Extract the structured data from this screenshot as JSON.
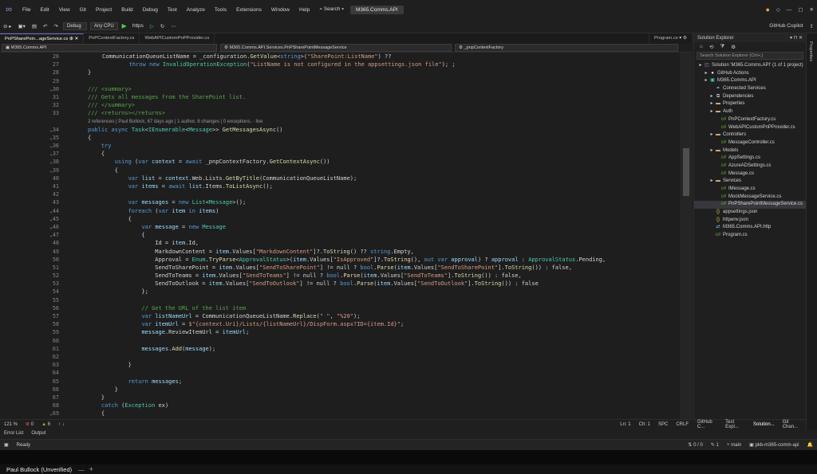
{
  "menu": [
    "File",
    "Edit",
    "View",
    "Git",
    "Project",
    "Build",
    "Debug",
    "Test",
    "Analyze",
    "Tools",
    "Extensions",
    "Window",
    "Help"
  ],
  "search_label": "Search",
  "window_title": "M365.Comms.API",
  "copilot_label": "GitHub Copilot",
  "toolbar": {
    "config": "Debug",
    "platform": "Any CPU",
    "run": "https"
  },
  "doc_tabs": [
    {
      "label": "PnPSharePoin...ageService.cs",
      "active": true
    },
    {
      "label": "PnPContextFactory.cs",
      "active": false
    },
    {
      "label": "WebAPICustomPnPProvider.cs",
      "active": false
    },
    {
      "label": "Program.cs",
      "active": false
    }
  ],
  "nav": {
    "project": "M365.Comms.API",
    "class": "M365.Comms.API.Services.PnPSharePointMessageService",
    "member": "_pnpContextFactory"
  },
  "codelens": "2 references | Paul Bullock, 67 days ago | 1 author, 8 changes | 0 exceptions, - live",
  "editor_status": {
    "zoom": "121 %",
    "errors": "0",
    "warnings": "6",
    "ln": "Ln: 1",
    "ch": "Ch: 1",
    "spc": "SPC",
    "crlf": "CRLF"
  },
  "output_tabs": [
    "Error List",
    "Output"
  ],
  "solution_explorer": {
    "title": "Solution Explorer",
    "search_placeholder": "Search Solution Explorer (Ctrl+;)",
    "items": [
      {
        "label": "Solution 'M365.Comms.API' (1 of 1 project)",
        "indent": 0,
        "icon": "solution-icon"
      },
      {
        "label": "GitHub Actions",
        "indent": 1,
        "icon": "github-icon"
      },
      {
        "label": "M365.Comms.API",
        "indent": 1,
        "icon": "project-icon"
      },
      {
        "label": "Connected Services",
        "indent": 2,
        "icon": "connected-icon"
      },
      {
        "label": "Dependencies",
        "indent": 2,
        "icon": "deps-icon"
      },
      {
        "label": "Properties",
        "indent": 2,
        "icon": "folder-icon"
      },
      {
        "label": "Auth",
        "indent": 2,
        "icon": "folder-icon"
      },
      {
        "label": "PnPContextFactory.cs",
        "indent": 3,
        "icon": "cs-icon"
      },
      {
        "label": "WebAPICustomPnPProvider.cs",
        "indent": 3,
        "icon": "cs-icon"
      },
      {
        "label": "Controllers",
        "indent": 2,
        "icon": "folder-icon"
      },
      {
        "label": "MessageController.cs",
        "indent": 3,
        "icon": "cs-icon"
      },
      {
        "label": "Models",
        "indent": 2,
        "icon": "folder-icon"
      },
      {
        "label": "AppSettings.cs",
        "indent": 3,
        "icon": "cs-icon"
      },
      {
        "label": "AzureADSettings.cs",
        "indent": 3,
        "icon": "cs-icon"
      },
      {
        "label": "Message.cs",
        "indent": 3,
        "icon": "cs-icon"
      },
      {
        "label": "Services",
        "indent": 2,
        "icon": "folder-icon"
      },
      {
        "label": "IMessage.cs",
        "indent": 3,
        "icon": "cs-icon"
      },
      {
        "label": "MockMessageService.cs",
        "indent": 3,
        "icon": "cs-icon"
      },
      {
        "label": "PnPSharePointMessageService.cs",
        "indent": 3,
        "icon": "cs-icon",
        "selected": true
      },
      {
        "label": "appsettings.json",
        "indent": 2,
        "icon": "json-icon"
      },
      {
        "label": "httpenv.json",
        "indent": 2,
        "icon": "json-icon"
      },
      {
        "label": "M365.Comms.API.http",
        "indent": 2,
        "icon": "http-icon"
      },
      {
        "label": "Program.cs",
        "indent": 2,
        "icon": "cs-icon"
      }
    ],
    "bottom_tabs": [
      "GitHub C...",
      "Test Expl...",
      "Solution...",
      "Git Chan..."
    ]
  },
  "status_bar": {
    "ready": "Ready",
    "counts": "0 / 0",
    "up": "1",
    "branch": "main",
    "repo": "pkb-m365-comm-api"
  },
  "bottom_tab": "Paul Bullock (Unverified)",
  "properties_label": "Properties",
  "line_numbers": [
    "26",
    "27",
    "28",
    "29",
    "30",
    "31",
    "32",
    "33",
    "34",
    "35",
    "36",
    "37",
    "38",
    "39",
    "40",
    "41",
    "42",
    "43",
    "44",
    "45",
    "46",
    "47",
    "48",
    "49",
    "50",
    "51",
    "52",
    "53",
    "54",
    "55",
    "56",
    "57",
    "58",
    "59",
    "60",
    "61",
    "62",
    "63",
    "64",
    "65",
    "66",
    "67",
    "68",
    "69"
  ],
  "code_lines": [
    "CommunicationQueueListName = _configuration.GetValue<string>(\"SharePoint:ListName\") ??",
    "        throw new InvalidOperationException(\"ListName is not configured in the appsettings.json file\"); ;",
    "}",
    "",
    "/// <summary>",
    "/// Gets all messages from the SharePoint list.",
    "/// </summary>",
    "/// <returns></returns>",
    "public async Task<IEnumerable<Message>> GetMessagesAsync()",
    "{",
    "    try",
    "    {",
    "        using (var context = await _pnpContextFactory.GetContextAsync())",
    "        {",
    "            var list = context.Web.Lists.GetByTitle(CommunicationQueueListName);",
    "            var items = await list.Items.ToListAsync();",
    "",
    "            var messages = new List<Message>();",
    "            foreach (var item in items)",
    "            {",
    "                var message = new Message",
    "                {",
    "                    Id = item.Id,",
    "                    MarkdownContent = item.Values[\"MarkdownContent\"]?.ToString() ?? string.Empty,",
    "                    Approval = Enum.TryParse<ApprovalStatus>(item.Values[\"IsApproved\"]?.ToString(), out var approval) ? approval : ApprovalStatus.Pending,",
    "                    SendToSharePoint = item.Values[\"SendToSharePoint\"] != null ? bool.Parse(item.Values[\"SendToSharePoint\"].ToString()) : false,",
    "                    SendToTeams = item.Values[\"SendToTeams\"] != null ? bool.Parse(item.Values[\"SendToTeams\"].ToString()) : false,",
    "                    SendToOutlook = item.Values[\"SendToOutlook\"] != null ? bool.Parse(item.Values[\"SendToOutlook\"].ToString()) : false",
    "                };",
    "",
    "                // Get the URL of the list item",
    "                var listNameUrl = CommunicationQueueListName.Replace(\" \", \"%20\");",
    "                var itemUrl = $\"{context.Uri}/Lists/{listNameUrl}/DispForm.aspx?ID={item.Id}\";",
    "                message.ReviewItemUrl = itemUrl;",
    "",
    "                messages.Add(message);",
    "",
    "            }",
    "",
    "            return messages;",
    "        }",
    "    }",
    "    catch (Exception ex)",
    "    {"
  ]
}
